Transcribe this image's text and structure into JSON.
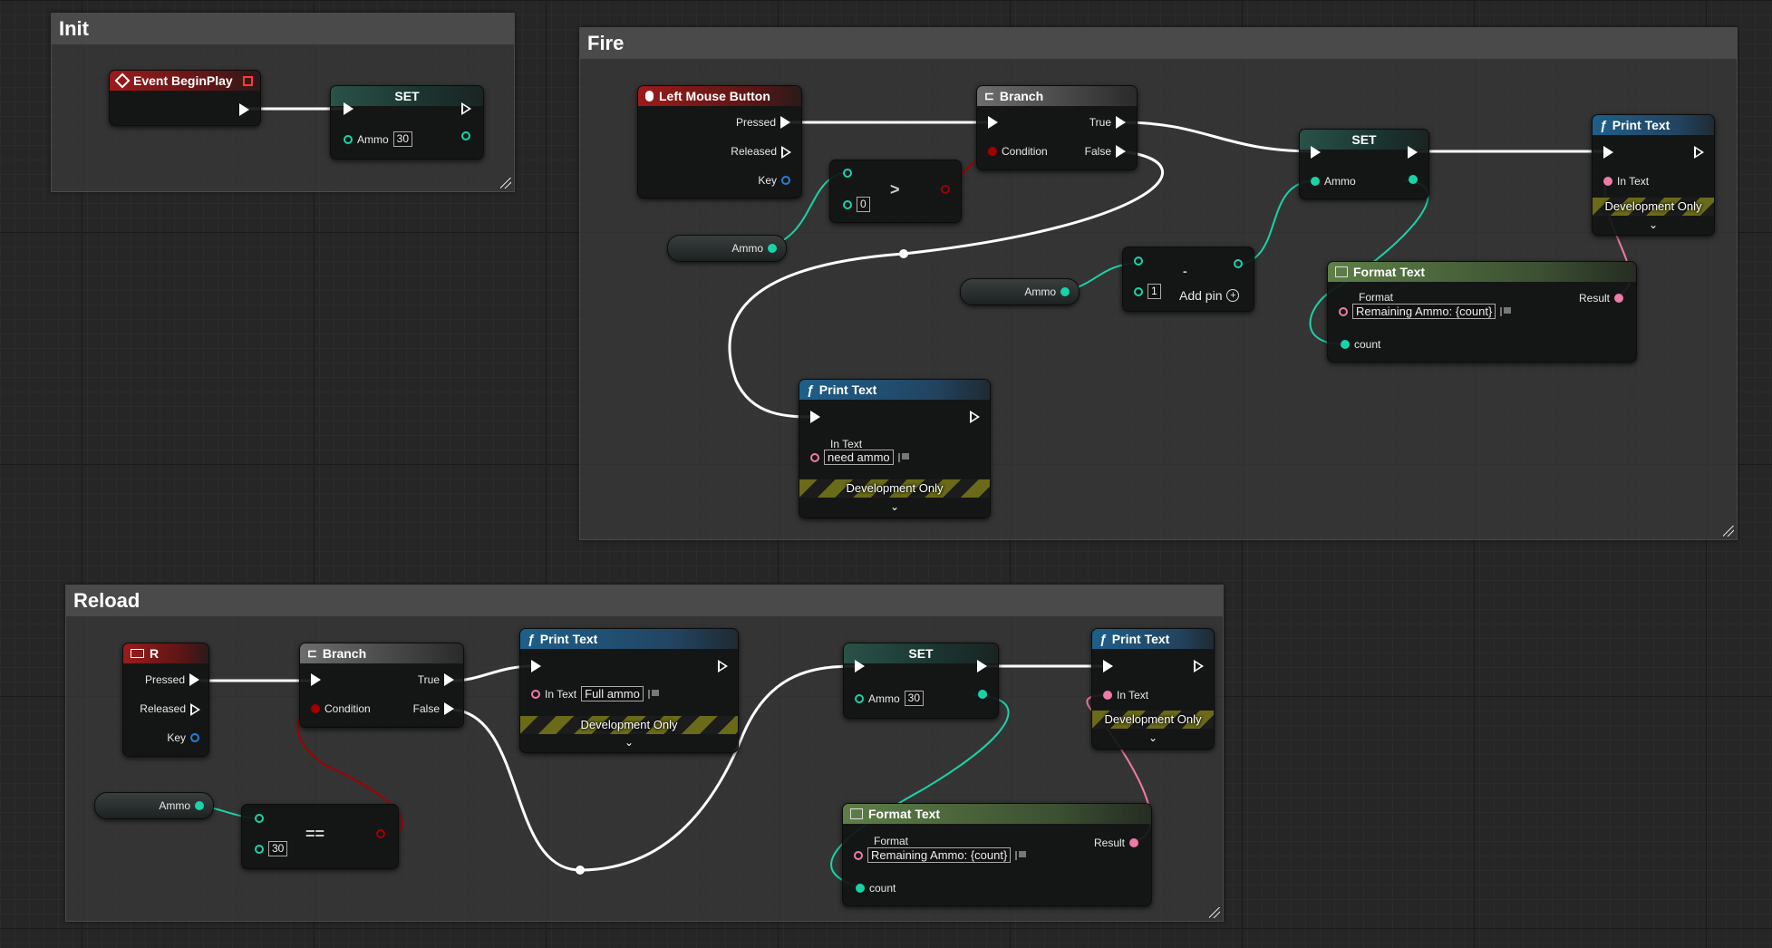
{
  "comments": {
    "init": "Init",
    "fire": "Fire",
    "reload": "Reload"
  },
  "init": {
    "event_title": "Event BeginPlay",
    "set_title": "SET",
    "ammo_label": "Ammo",
    "ammo_value": "30"
  },
  "fire": {
    "lmb_title": "Left Mouse Button",
    "pressed": "Pressed",
    "released": "Released",
    "key": "Key",
    "ammo_getter": "Ammo",
    "compare_value": "0",
    "compare_op": ">",
    "branch_title": "Branch",
    "condition": "Condition",
    "true_label": "True",
    "false_label": "False",
    "print_title": "Print Text",
    "in_text": "In Text",
    "need_ammo": "need ammo",
    "dev_only": "Development Only",
    "ammo_getter2": "Ammo",
    "subtract_op": "-",
    "subtract_value": "1",
    "add_pin": "Add pin",
    "set_title": "SET",
    "set_ammo": "Ammo",
    "format_title": "Format Text",
    "format_label": "Format",
    "format_value": "Remaining Ammo: {count}",
    "result": "Result",
    "count": "count",
    "print2_title": "Print Text",
    "print2_in": "In Text",
    "print2_dev": "Development Only"
  },
  "reload": {
    "r_title": "R",
    "pressed": "Pressed",
    "released": "Released",
    "key": "Key",
    "ammo_getter": "Ammo",
    "eq_value": "30",
    "eq_op": "==",
    "branch_title": "Branch",
    "condition": "Condition",
    "true_label": "True",
    "false_label": "False",
    "print_title": "Print Text",
    "in_text": "In Text",
    "full_ammo": "Full ammo",
    "dev_only": "Development Only",
    "set_title": "SET",
    "set_ammo": "Ammo",
    "set_value": "30",
    "format_title": "Format Text",
    "format_label": "Format",
    "format_value": "Remaining Ammo: {count}",
    "result": "Result",
    "count": "count",
    "print2_title": "Print Text",
    "print2_in": "In Text",
    "print2_dev": "Development Only"
  },
  "colors": {
    "exec_wire": "#ffffff",
    "int_wire": "#19d3a8",
    "bool_wire": "#a10000",
    "text_wire": "#f07aa8"
  }
}
